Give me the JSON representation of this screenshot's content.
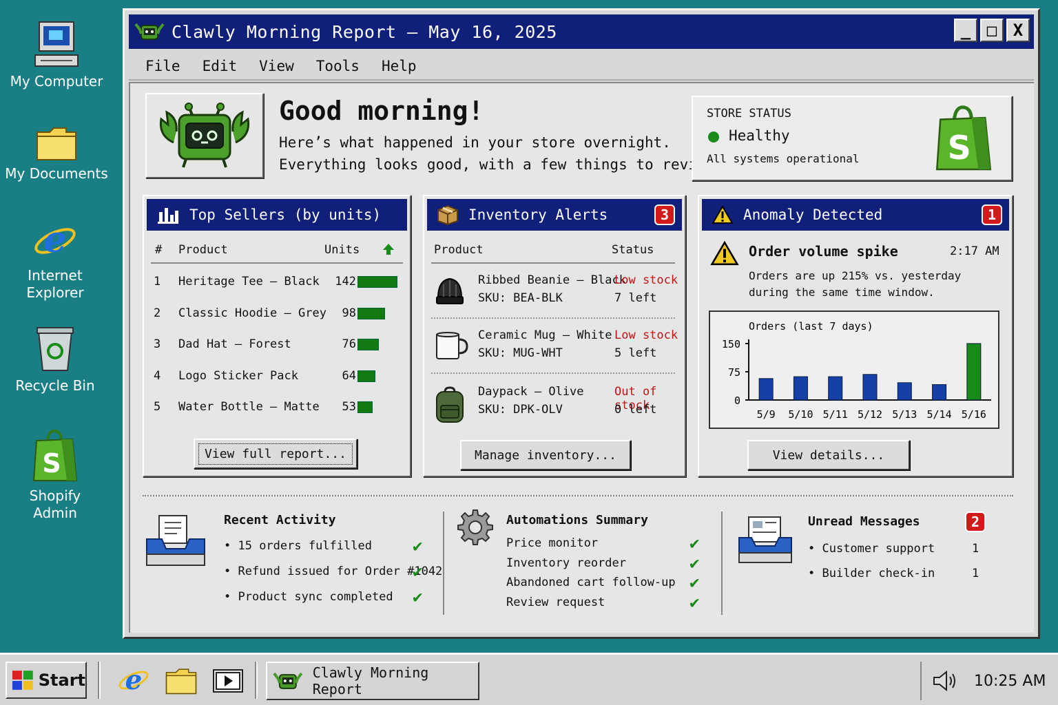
{
  "desktop": {
    "icons": [
      {
        "label": "My Computer"
      },
      {
        "label": "My Documents"
      },
      {
        "label_line1": "Internet",
        "label_line2": "Explorer"
      },
      {
        "label": "Recycle Bin"
      },
      {
        "label_line1": "Shopify",
        "label_line2": "Admin"
      }
    ]
  },
  "window": {
    "title": "Clawly Morning Report – May 16, 2025",
    "controls": {
      "minimize": "_",
      "maximize": "□",
      "close": "X"
    },
    "menu": [
      "File",
      "Edit",
      "View",
      "Tools",
      "Help"
    ]
  },
  "greeting": {
    "title": "Good morning!",
    "line1": "Here’s what happened in your store overnight.",
    "line2": "Everything looks good, with a few things to review."
  },
  "store_status": {
    "label": "STORE STATUS",
    "value": "Healthy",
    "sub": "All systems operational",
    "status_color": "#1a8a1a"
  },
  "top_sellers": {
    "title": "Top Sellers (by units)",
    "col_rank": "#",
    "col_product": "Product",
    "col_units": "Units",
    "rows": [
      {
        "rank": "1",
        "product": "Heritage Tee – Black",
        "units": 142
      },
      {
        "rank": "2",
        "product": "Classic Hoodie – Grey",
        "units": 98
      },
      {
        "rank": "3",
        "product": "Dad Hat – Forest",
        "units": 76
      },
      {
        "rank": "4",
        "product": "Logo Sticker Pack",
        "units": 64
      },
      {
        "rank": "5",
        "product": "Water Bottle – Matte",
        "units": 53
      }
    ],
    "button": "View full report..."
  },
  "inventory": {
    "title": "Inventory Alerts",
    "badge": "3",
    "col_product": "Product",
    "col_status": "Status",
    "rows": [
      {
        "name": "Ribbed Beanie – Black",
        "sku": "SKU: BEA-BLK",
        "status": "Low stock",
        "left": "7 left",
        "icon": "beanie-icon"
      },
      {
        "name": "Ceramic Mug – White",
        "sku": "SKU: MUG-WHT",
        "status": "Low stock",
        "left": "5 left",
        "icon": "mug-icon"
      },
      {
        "name": "Daypack – Olive",
        "sku": "SKU: DPK-OLV",
        "status": "Out of stock",
        "left": "0 left",
        "icon": "backpack-icon"
      }
    ],
    "button": "Manage inventory..."
  },
  "anomaly": {
    "title": "Anomaly Detected",
    "badge": "1",
    "headline": "Order volume spike",
    "time": "2:17 AM",
    "line1": "Orders are up 215% vs. yesterday",
    "line2": "during the same time window.",
    "button": "View details..."
  },
  "chart_data": {
    "type": "bar",
    "title": "Orders (last 7 days)",
    "categories": [
      "5/9",
      "5/10",
      "5/11",
      "5/12",
      "5/13",
      "5/14",
      "5/16"
    ],
    "values": [
      57,
      62,
      62,
      68,
      46,
      41,
      150
    ],
    "yticks": [
      0,
      75,
      150
    ],
    "ylim": [
      0,
      150
    ],
    "colors": {
      "normal": "#1540a8",
      "highlight": "#178a17"
    },
    "highlight_index": 6,
    "grid": false
  },
  "recent_activity": {
    "title": "Recent Activity",
    "items": [
      "15 orders fulfilled",
      "Refund issued for Order #1042",
      "Product sync completed"
    ]
  },
  "automations": {
    "title": "Automations Summary",
    "items": [
      "Price monitor",
      "Inventory reorder",
      "Abandoned cart follow-up",
      "Review request"
    ]
  },
  "messages": {
    "title": "Unread Messages",
    "badge": "2",
    "items": [
      {
        "label": "Customer support",
        "count": "1"
      },
      {
        "label": "Builder check-in",
        "count": "1"
      }
    ]
  },
  "taskbar": {
    "start": "Start",
    "task": "Clawly Morning Report",
    "clock": "10:25 AM"
  }
}
